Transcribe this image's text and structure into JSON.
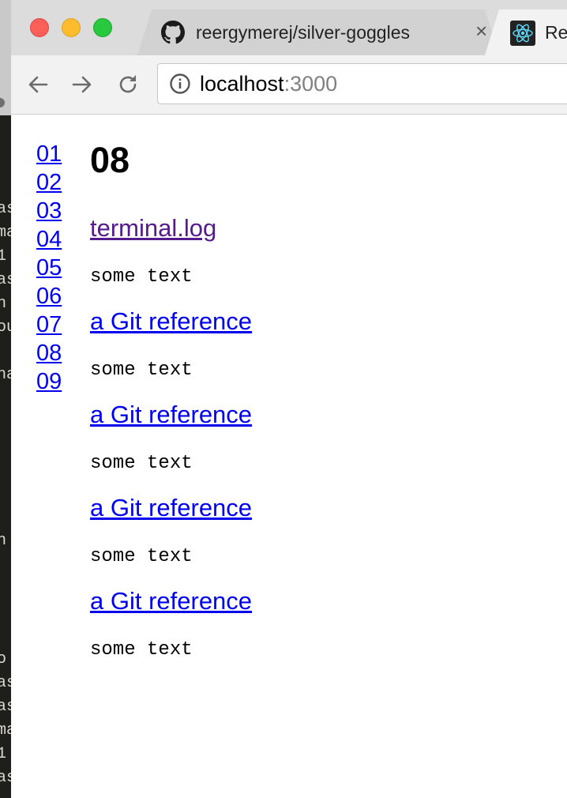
{
  "browser": {
    "tabs": [
      {
        "title": "reergymerej/silver-goggles",
        "icon": "github-icon",
        "close_label": "×"
      },
      {
        "title": "Re",
        "icon": "react-icon"
      }
    ],
    "address": {
      "host": "localhost",
      "port": ":3000"
    }
  },
  "terminal": {
    "lines": [
      "as",
      "ma",
      "1",
      "as",
      "n",
      "ou",
      "ha",
      "n",
      "o",
      "as",
      "as",
      "ma",
      "1",
      "as"
    ]
  },
  "page": {
    "nav": [
      "01",
      "02",
      "03",
      "04",
      "05",
      "06",
      "07",
      "08",
      "09"
    ],
    "title": "08",
    "items": [
      {
        "kind": "link",
        "text": "terminal.log",
        "visited": true
      },
      {
        "kind": "text",
        "text": "some text"
      },
      {
        "kind": "link",
        "text": "a Git reference"
      },
      {
        "kind": "text",
        "text": "some text"
      },
      {
        "kind": "link",
        "text": "a Git reference"
      },
      {
        "kind": "text",
        "text": "some text"
      },
      {
        "kind": "link",
        "text": "a Git reference"
      },
      {
        "kind": "text",
        "text": "some text"
      },
      {
        "kind": "link",
        "text": "a Git reference"
      },
      {
        "kind": "text",
        "text": "some text"
      }
    ]
  },
  "colors": {
    "link": "#0000ee",
    "visited": "#551a8b"
  }
}
